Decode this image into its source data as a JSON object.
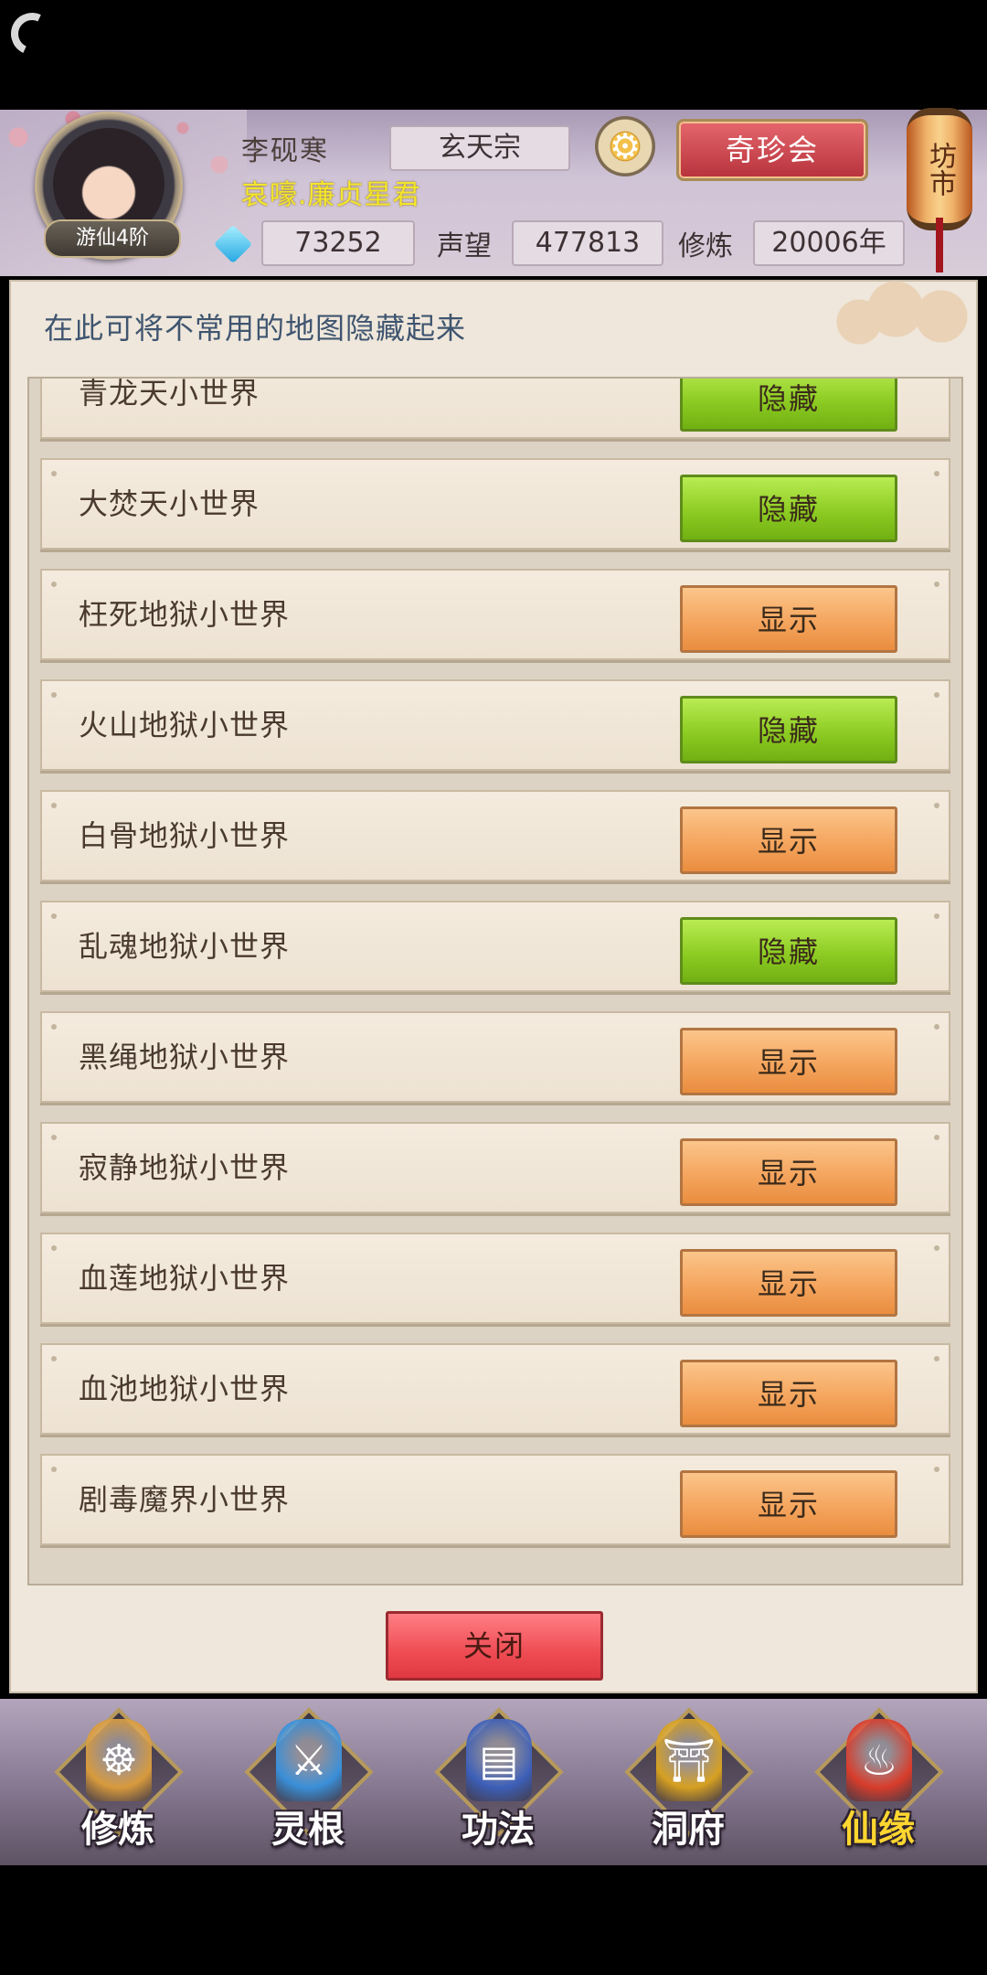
{
  "player": {
    "rank": "游仙4阶",
    "name": "李砚寒",
    "title": "哀嚎.廉贞星君",
    "sect": "玄天宗"
  },
  "stats": {
    "gems": "73252",
    "reputation_label": "声望",
    "reputation": "477813",
    "cultivation_label": "修炼",
    "cultivation": "20006年"
  },
  "header": {
    "market_button": "奇珍会",
    "lantern_text": "坊市"
  },
  "panel": {
    "hint": "在此可将不常用的地图隐藏起来",
    "rows": [
      {
        "name": "青龙天小世界",
        "action": "隐藏",
        "state": "hide"
      },
      {
        "name": "大焚天小世界",
        "action": "隐藏",
        "state": "hide"
      },
      {
        "name": "枉死地狱小世界",
        "action": "显示",
        "state": "show"
      },
      {
        "name": "火山地狱小世界",
        "action": "隐藏",
        "state": "hide"
      },
      {
        "name": "白骨地狱小世界",
        "action": "显示",
        "state": "show"
      },
      {
        "name": "乱魂地狱小世界",
        "action": "隐藏",
        "state": "hide"
      },
      {
        "name": "黑绳地狱小世界",
        "action": "显示",
        "state": "show"
      },
      {
        "name": "寂静地狱小世界",
        "action": "显示",
        "state": "show"
      },
      {
        "name": "血莲地狱小世界",
        "action": "显示",
        "state": "show"
      },
      {
        "name": "血池地狱小世界",
        "action": "显示",
        "state": "show"
      },
      {
        "name": "剧毒魔界小世界",
        "action": "显示",
        "state": "show"
      }
    ],
    "close_button": "关闭"
  },
  "nav": {
    "items": [
      {
        "label": "修炼",
        "icon": "meditating-figure-icon",
        "color": "#d89a3c"
      },
      {
        "label": "灵根",
        "icon": "sword-yinyang-icon",
        "color": "#3a8fd8"
      },
      {
        "label": "功法",
        "icon": "scroll-book-icon",
        "color": "#3c5fb8"
      },
      {
        "label": "洞府",
        "icon": "pagoda-icon",
        "color": "#d6a021"
      },
      {
        "label": "仙缘",
        "icon": "gourd-icon",
        "color": "#d83c2a"
      }
    ]
  }
}
